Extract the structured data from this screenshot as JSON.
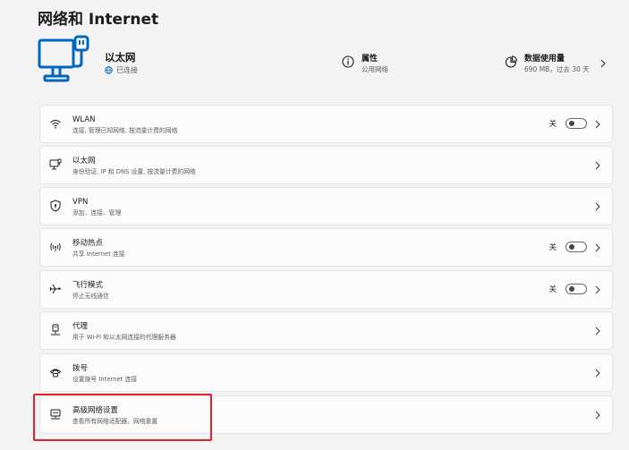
{
  "page": {
    "title": "网络和 Internet"
  },
  "hero": {
    "name": "以太网",
    "status": "已连接",
    "properties": {
      "title": "属性",
      "subtitle": "公用网络"
    },
    "data_usage": {
      "title": "数据使用量",
      "subtitle": "690 MB，过去 30 天"
    }
  },
  "colors": {
    "accent": "#0067c0",
    "highlight": "#e5202a"
  },
  "items": [
    {
      "label": "WLAN",
      "desc": "连接, 管理已知网络, 按流量计费的网络",
      "icon": "wifi-icon",
      "toggle_label": "关",
      "toggle": false
    },
    {
      "label": "以太网",
      "desc": "身份验证, IP 和 DNS 设置, 按流量计费的网络",
      "icon": "ethernet-icon"
    },
    {
      "label": "VPN",
      "desc": "添加、连接、管理",
      "icon": "shield-icon"
    },
    {
      "label": "移动热点",
      "desc": "共享 Internet 连接",
      "icon": "hotspot-icon",
      "toggle_label": "关",
      "toggle": false
    },
    {
      "label": "飞行模式",
      "desc": "停止无线通信",
      "icon": "airplane-icon",
      "toggle_label": "关",
      "toggle": false
    },
    {
      "label": "代理",
      "desc": "用于 Wi-Fi 和以太网连接的代理服务器",
      "icon": "proxy-icon"
    },
    {
      "label": "拨号",
      "desc": "设置拨号 Internet 连接",
      "icon": "dialup-icon"
    },
    {
      "label": "高级网络设置",
      "desc": "查看所有网络适配器，网络重置",
      "icon": "advanced-network-icon"
    }
  ]
}
